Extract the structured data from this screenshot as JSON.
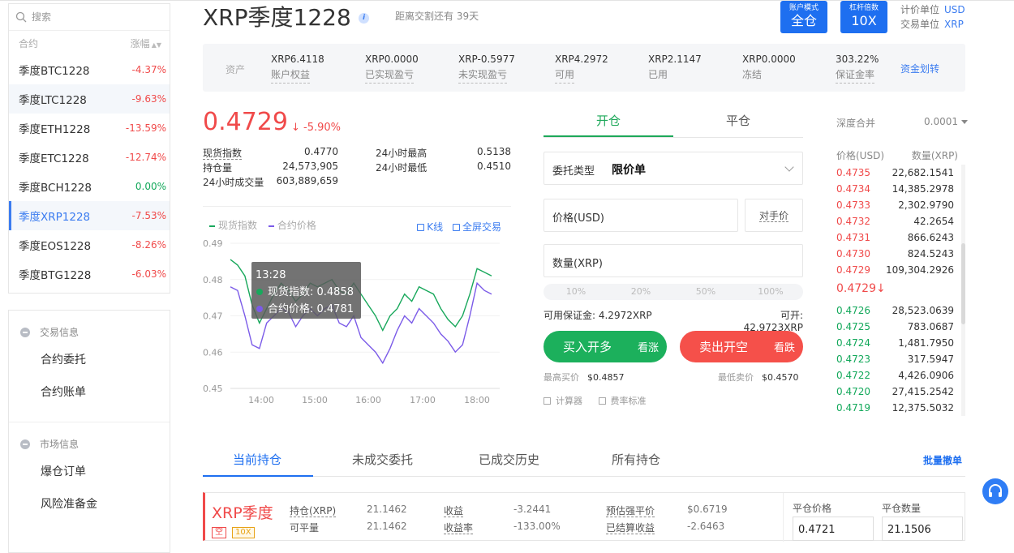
{
  "sidebar": {
    "search_placeholder": "搜索",
    "col_contract": "合约",
    "col_change": "涨幅",
    "coins": [
      {
        "name": "季度BTC1228",
        "change": "-4.37%",
        "dir": "neg"
      },
      {
        "name": "季度LTC1228",
        "change": "-9.63%",
        "dir": "neg"
      },
      {
        "name": "季度ETH1228",
        "change": "-13.59%",
        "dir": "neg"
      },
      {
        "name": "季度ETC1228",
        "change": "-12.74%",
        "dir": "neg"
      },
      {
        "name": "季度BCH1228",
        "change": "0.00%",
        "dir": "pos"
      },
      {
        "name": "季度XRP1228",
        "change": "-7.53%",
        "dir": "neg"
      },
      {
        "name": "季度EOS1228",
        "change": "-8.26%",
        "dir": "neg"
      },
      {
        "name": "季度BTG1228",
        "change": "-6.03%",
        "dir": "neg"
      }
    ],
    "group1": "交易信息",
    "group1_items": [
      "合约委托",
      "合约账单"
    ],
    "group2": "市场信息",
    "group2_items": [
      "爆仓订单",
      "风险准备金"
    ]
  },
  "header": {
    "title": "XRP季度1228",
    "countdown": "距离交割还有 39天",
    "mode_small": "账户模式",
    "mode_big": "全仓",
    "lev_small": "杠杆倍数",
    "lev_big": "10X",
    "price_unit_label": "计价单位",
    "price_unit": "USD",
    "trade_unit_label": "交易单位",
    "trade_unit": "XRP"
  },
  "assets": {
    "label": "资产",
    "items": [
      {
        "value": "XRP6.4118",
        "label": "账户权益"
      },
      {
        "value": "XRP0.0000",
        "label": "已实现盈亏"
      },
      {
        "value": "XRP-0.5977",
        "label": "未实现盈亏"
      },
      {
        "value": "XRP4.2972",
        "label": "可用"
      },
      {
        "value": "XRP2.1147",
        "label": "已用"
      },
      {
        "value": "XRP0.0000",
        "label": "冻结"
      },
      {
        "value": "303.22%",
        "label": "保证金率"
      }
    ],
    "transfer": "资金划转"
  },
  "ticker": {
    "price": "0.4729",
    "change": "↓ -5.90%",
    "spot_label": "现货指数",
    "spot": "0.4770",
    "high_label": "24小时最高",
    "high": "0.5138",
    "oi_label": "持仓量",
    "oi": "24,573,905",
    "low_label": "24小时最低",
    "low": "0.4510",
    "vol_label": "24小时成交量",
    "vol": "603,889,659"
  },
  "chart": {
    "legend_spot": "现货指数",
    "legend_contract": "合约价格",
    "kline": "K线",
    "fullscreen": "全屏交易",
    "tooltip_time": "13:28",
    "tooltip_spot": "现货指数: 0.4858",
    "tooltip_contract": "合约价格: 0.4781",
    "color_spot": "#19a85c",
    "color_contract": "#7b5be8"
  },
  "chart_data": {
    "type": "line",
    "ylim": [
      0.45,
      0.49
    ],
    "yticks": [
      "0.49",
      "0.48",
      "0.47",
      "0.46",
      "0.45"
    ],
    "xticks": [
      "14:00",
      "15:00",
      "16:00",
      "17:00",
      "18:00"
    ],
    "series": [
      {
        "name": "现货指数",
        "values": [
          0.4855,
          0.484,
          0.481,
          0.473,
          0.468,
          0.472,
          0.476,
          0.479,
          0.477,
          0.474,
          0.476,
          0.479,
          0.478,
          0.479,
          0.48,
          0.477,
          0.476,
          0.479,
          0.476,
          0.473,
          0.47,
          0.466,
          0.47,
          0.472,
          0.476,
          0.474,
          0.478,
          0.477,
          0.476,
          0.472,
          0.469,
          0.467,
          0.47,
          0.476,
          0.483,
          0.482,
          0.481
        ]
      },
      {
        "name": "合约价格",
        "values": [
          0.478,
          0.477,
          0.47,
          0.462,
          0.461,
          0.468,
          0.47,
          0.472,
          0.471,
          0.467,
          0.47,
          0.472,
          0.47,
          0.472,
          0.473,
          0.468,
          0.467,
          0.47,
          0.464,
          0.462,
          0.46,
          0.457,
          0.461,
          0.466,
          0.47,
          0.468,
          0.472,
          0.47,
          0.468,
          0.465,
          0.463,
          0.46,
          0.462,
          0.47,
          0.479,
          0.477,
          0.476
        ]
      }
    ]
  },
  "trade": {
    "tab_open": "开仓",
    "tab_close": "平仓",
    "order_type_label": "委托类型",
    "order_type": "限价单",
    "price_placeholder": "价格(USD)",
    "counterparty": "对手价",
    "qty_placeholder": "数量(XRP)",
    "pcts": [
      "10%",
      "20%",
      "50%",
      "100%"
    ],
    "avail_margin": "可用保证金: 4.2972XRP",
    "can_open": "可开: 42.9723XRP",
    "buy_main": "买入开多",
    "buy_sub": "看涨",
    "sell_main": "卖出开空",
    "sell_sub": "看跌",
    "best_bid_label": "最高买价",
    "best_bid": "$0.4857",
    "best_ask_label": "最低卖价",
    "best_ask": "$0.4570",
    "calculator": "计算器",
    "fee": "费率标准"
  },
  "orderbook": {
    "depth_label": "深度合并",
    "precision": "0.0001",
    "col_price": "价格(USD)",
    "col_qty": "数量(XRP)",
    "asks": [
      {
        "p": "0.4735",
        "q": "22,682.1541"
      },
      {
        "p": "0.4734",
        "q": "14,385.2978"
      },
      {
        "p": "0.4733",
        "q": "2,302.9790"
      },
      {
        "p": "0.4732",
        "q": "42.2654"
      },
      {
        "p": "0.4731",
        "q": "866.6243"
      },
      {
        "p": "0.4730",
        "q": "824.5243"
      },
      {
        "p": "0.4729",
        "q": "109,304.2926"
      }
    ],
    "mid": "0.4729↓",
    "bids": [
      {
        "p": "0.4726",
        "q": "28,523.0639"
      },
      {
        "p": "0.4725",
        "q": "783.0687"
      },
      {
        "p": "0.4724",
        "q": "1,481.7950"
      },
      {
        "p": "0.4723",
        "q": "317.5947"
      },
      {
        "p": "0.4722",
        "q": "4,426.0906"
      },
      {
        "p": "0.4720",
        "q": "27,415.2542"
      },
      {
        "p": "0.4719",
        "q": "12,375.5032"
      }
    ]
  },
  "bottom": {
    "tabs": [
      "当前持仓",
      "未成交委托",
      "已成交历史",
      "所有持仓"
    ],
    "batch": "批量撤单",
    "position": {
      "name": "XRP季度",
      "tag_side": "空",
      "tag_lev": "10X",
      "rows": [
        {
          "k1": "持仓(XRP)",
          "v1": "21.1462",
          "k2": "收益",
          "v2": "-3.2441",
          "k3": "预估强平价",
          "v3": "$0.6719"
        },
        {
          "k1": "可平量",
          "v1": "21.1462",
          "k2": "收益率",
          "v2": "-133.00%",
          "k3": "已结算收益",
          "v3": "-2.6463"
        }
      ],
      "close_price_label": "平仓价格",
      "close_price": "0.4721",
      "close_qty_label": "平仓数量",
      "close_qty": "21.1506"
    }
  }
}
